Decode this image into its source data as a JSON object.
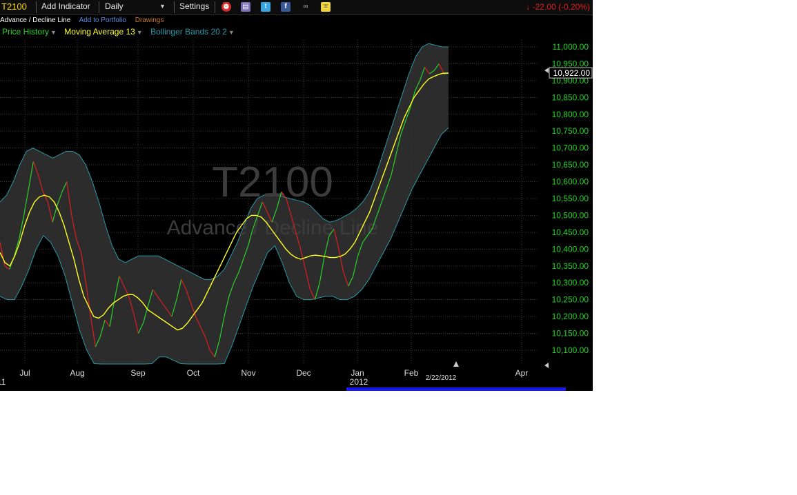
{
  "toolbar": {
    "symbol": "T2100",
    "add_indicator": "Add Indicator",
    "period": "Daily",
    "settings": "Settings",
    "icons": [
      "alarm-clock-icon",
      "book-icon",
      "twitter-icon",
      "facebook-icon",
      "binoculars-icon",
      "note-icon"
    ],
    "change": "-22.00 (-0.20%)",
    "change_arrow": "↓"
  },
  "subbar": {
    "name": "Advance / Decline Line",
    "add_portfolio": "Add to Portfolio",
    "drawings": "Drawings"
  },
  "legend": {
    "price_history": "Price History",
    "moving_average": "Moving Average 13",
    "bollinger": "Bollinger Bands 20 2"
  },
  "watermark": {
    "symbol": "T2100",
    "name": "Advance / Decline Line"
  },
  "colors": {
    "up": "#28d228",
    "down": "#e01e1e",
    "ma": "#ffff22",
    "band": "#2e2e2e",
    "band_edge": "#2a9aa8",
    "axis_text": "#22d622"
  },
  "chart_data": {
    "type": "line",
    "y_ticks": [
      11000,
      10950,
      10900,
      10850,
      10800,
      10750,
      10700,
      10650,
      10600,
      10550,
      10500,
      10450,
      10400,
      10350,
      10300,
      10250,
      10200,
      10150,
      10100
    ],
    "y_tick_labels": [
      "11,000.00",
      "10,950.00",
      "10,900.00",
      "10,850.00",
      "10,800.00",
      "10,750.00",
      "10,700.00",
      "10,650.00",
      "10,600.00",
      "10,550.00",
      "10,500.00",
      "10,450.00",
      "10,400.00",
      "10,350.00",
      "10,300.00",
      "10,250.00",
      "10,200.00",
      "10,150.00",
      "10,100.00"
    ],
    "last_value": "10,922.00",
    "x_months": [
      "Jul",
      "Aug",
      "Sep",
      "Oct",
      "Nov",
      "Dec",
      "Jan",
      "Feb",
      "Apr"
    ],
    "x_year": "2012",
    "x_left_partial": "11",
    "cursor_date": "2/22/2012",
    "price": [
      10420,
      10350,
      10340,
      10380,
      10430,
      10500,
      10580,
      10660,
      10620,
      10570,
      10540,
      10480,
      10530,
      10570,
      10600,
      10500,
      10430,
      10390,
      10300,
      10200,
      10110,
      10140,
      10190,
      10170,
      10250,
      10320,
      10290,
      10260,
      10210,
      10150,
      10180,
      10230,
      10280,
      10260,
      10240,
      10220,
      10200,
      10250,
      10310,
      10280,
      10240,
      10200,
      10170,
      10140,
      10100,
      10080,
      10130,
      10200,
      10260,
      10300,
      10330,
      10370,
      10410,
      10460,
      10500,
      10540,
      10510,
      10480,
      10520,
      10570,
      10550,
      10500,
      10450,
      10400,
      10340,
      10280,
      10250,
      10300,
      10380,
      10440,
      10460,
      10400,
      10330,
      10290,
      10320,
      10380,
      10420,
      10440,
      10460,
      10500,
      10540,
      10580,
      10620,
      10680,
      10740,
      10780,
      10820,
      10870,
      10900,
      10940,
      10920,
      10930,
      10950,
      10920,
      10922
    ],
    "ma": [
      10390,
      10360,
      10350,
      10380,
      10420,
      10470,
      10510,
      10540,
      10555,
      10560,
      10555,
      10540,
      10510,
      10470,
      10420,
      10370,
      10310,
      10260,
      10230,
      10200,
      10195,
      10205,
      10225,
      10240,
      10250,
      10260,
      10265,
      10265,
      10255,
      10240,
      10220,
      10210,
      10200,
      10190,
      10180,
      10170,
      10160,
      10165,
      10180,
      10200,
      10220,
      10240,
      10270,
      10300,
      10330,
      10360,
      10390,
      10420,
      10450,
      10470,
      10490,
      10500,
      10500,
      10495,
      10480,
      10460,
      10440,
      10420,
      10400,
      10385,
      10375,
      10370,
      10375,
      10380,
      10382,
      10380,
      10378,
      10375,
      10375,
      10378,
      10385,
      10400,
      10420,
      10450,
      10480,
      10510,
      10550,
      10590,
      10630,
      10670,
      10710,
      10750,
      10790,
      10820,
      10850,
      10870,
      10890,
      10905,
      10912,
      10918,
      10922,
      10922
    ],
    "upper": [
      10540,
      10560,
      10600,
      10650,
      10690,
      10700,
      10690,
      10680,
      10670,
      10680,
      10690,
      10690,
      10680,
      10650,
      10600,
      10540,
      10470,
      10410,
      10370,
      10360,
      10370,
      10380,
      10380,
      10380,
      10380,
      10370,
      10360,
      10350,
      10340,
      10330,
      10320,
      10310,
      10310,
      10320,
      10340,
      10380,
      10420,
      10470,
      10520,
      10550,
      10560,
      10565,
      10560,
      10555,
      10550,
      10545,
      10540,
      10530,
      10510,
      10490,
      10480,
      10485,
      10495,
      10505,
      10520,
      10540,
      10570,
      10620,
      10680,
      10740,
      10800,
      10860,
      10920,
      10970,
      11000,
      11010,
      11005,
      11000,
      11000
    ],
    "lower": [
      10260,
      10250,
      10250,
      10290,
      10340,
      10400,
      10440,
      10420,
      10380,
      10320,
      10240,
      10160,
      10100,
      10060,
      10040,
      10030,
      10030,
      10030,
      10030,
      10030,
      10040,
      10060,
      10080,
      10080,
      10070,
      10060,
      10050,
      10040,
      10030,
      10030,
      10030,
      10060,
      10110,
      10170,
      10230,
      10290,
      10340,
      10390,
      10410,
      10360,
      10300,
      10260,
      10250,
      10250,
      10255,
      10260,
      10260,
      10250,
      10250,
      10260,
      10280,
      10310,
      10350,
      10390,
      10430,
      10480,
      10530,
      10580,
      10620,
      10660,
      10700,
      10740,
      10760
    ]
  }
}
